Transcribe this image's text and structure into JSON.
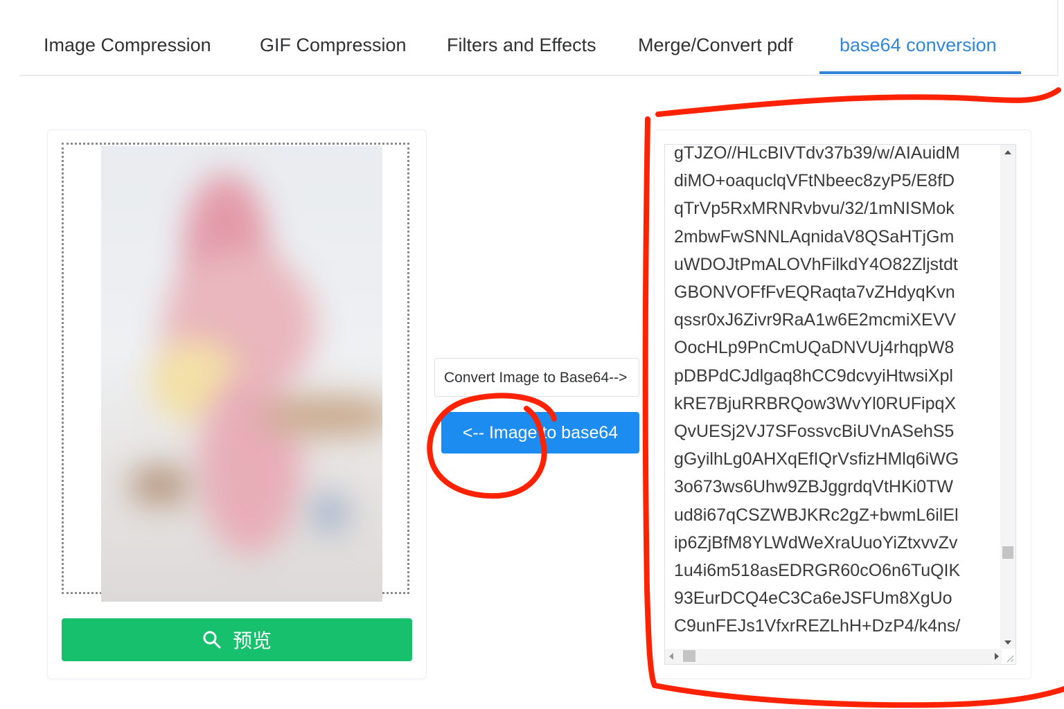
{
  "tabs": [
    {
      "label": "Image Compression",
      "active": false
    },
    {
      "label": "GIF Compression",
      "active": false
    },
    {
      "label": "Filters and Effects",
      "active": false
    },
    {
      "label": "Merge/Convert pdf",
      "active": false
    },
    {
      "label": "base64 conversion",
      "active": true
    }
  ],
  "colors": {
    "accent": "#2f86d8",
    "preview_button": "#17c06d",
    "primary_button": "#1c8cf0",
    "annotation": "#ff2200"
  },
  "left_panel": {
    "preview_image": "blurred-photo",
    "preview_button": {
      "icon": "search-icon",
      "label": "预览"
    }
  },
  "middle": {
    "convert_label": "Convert Image to Base64-->",
    "image_to_base64_button": "<-- Image to base64"
  },
  "output": {
    "lines": [
      "gTJZO//HLcBIVTdv37b39/w/AIAuidM",
      "diMO+oaquclqVFtNbeec8zyP5/E8fD",
      "qTrVp5RxMRNRvbvu/32/1mNISMok",
      "2mbwFwSNNLAqnidaV8QSaHTjGm",
      "uWDOJtPmALOVhFilkdY4O82Zljstdt",
      "GBONVOFfFvEQRaqta7vZHdyqKvn",
      "qssr0xJ6Zivr9RaA1w6E2mcmiXEVV",
      "OocHLp9PnCmUQaDNVUj4rhqpW8",
      "pDBPdCJdlgaq8hCC9dcvyiHtwsiXpl",
      "kRE7BjuRRBRQow3WvYl0RUFipqX",
      "QvUESj2VJ7SFossvcBiUVnASehS5",
      "gGyilhLg0AHXqEfIQrVsfizHMlq6iWG",
      "3o673ws6Uhw9ZBJggrdqVtHKi0TW",
      "ud8i67qCSZWBJKRc2gZ+bwmL6ilEl",
      "ip6ZjBfM8YLWdWeXraUuoYiZtxvvZv",
      "1u4i6m518asEDRGR60cO6n6TuQIK",
      "93EurDCQ4eC3Ca6eJSFUm8XgUo",
      "C9unFEJs1VfxrREZLhH+DzP4/k4ns/"
    ]
  }
}
